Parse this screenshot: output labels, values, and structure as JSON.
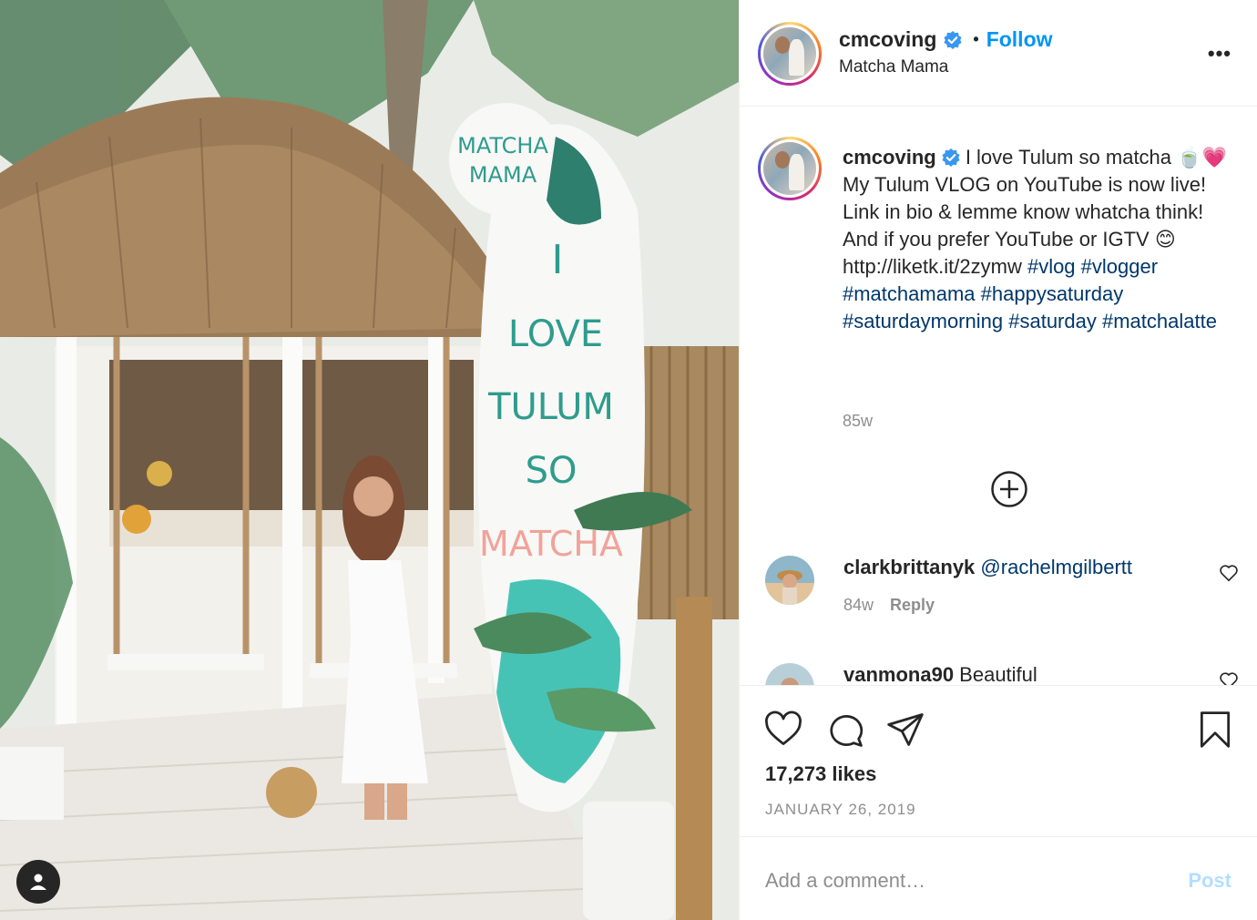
{
  "post": {
    "username": "cmcoving",
    "location": "Matcha Mama",
    "follow_label": "Follow",
    "separator": "•",
    "more_label": "•••",
    "photo_sign_lines": [
      "MATCHA",
      "MAMA",
      "I",
      "LOVE",
      "TULUM",
      "SO",
      "MATCHA"
    ]
  },
  "caption": {
    "username": "cmcoving",
    "text_1": " I love Tulum so matcha 🍵💗 My Tulum VLOG on YouTube is now live! Link in bio & lemme know whatcha think! And if you prefer YouTube or IGTV 😊 http://liketk.it/2zymw ",
    "hashtags": [
      "#vlog",
      "#vlogger",
      "#matchamama",
      "#happysaturday",
      "#saturdaymorning",
      "#saturday",
      "#matchalatte"
    ],
    "time": "85w"
  },
  "comments": [
    {
      "username": "clarkbrittanyk",
      "text": "@rachelmgilbertt",
      "time": "84w",
      "reply_label": "Reply"
    },
    {
      "username": "vanmona90",
      "text": " Beautiful"
    }
  ],
  "actions": {
    "likes": "17,273 likes",
    "date": "JANUARY 26, 2019"
  },
  "add_comment": {
    "placeholder": "Add a comment…",
    "post_label": "Post"
  },
  "colors": {
    "link": "#00376b",
    "follow": "#0095f6",
    "muted": "#8e8e8e",
    "post_disabled": "#b2dffc"
  }
}
